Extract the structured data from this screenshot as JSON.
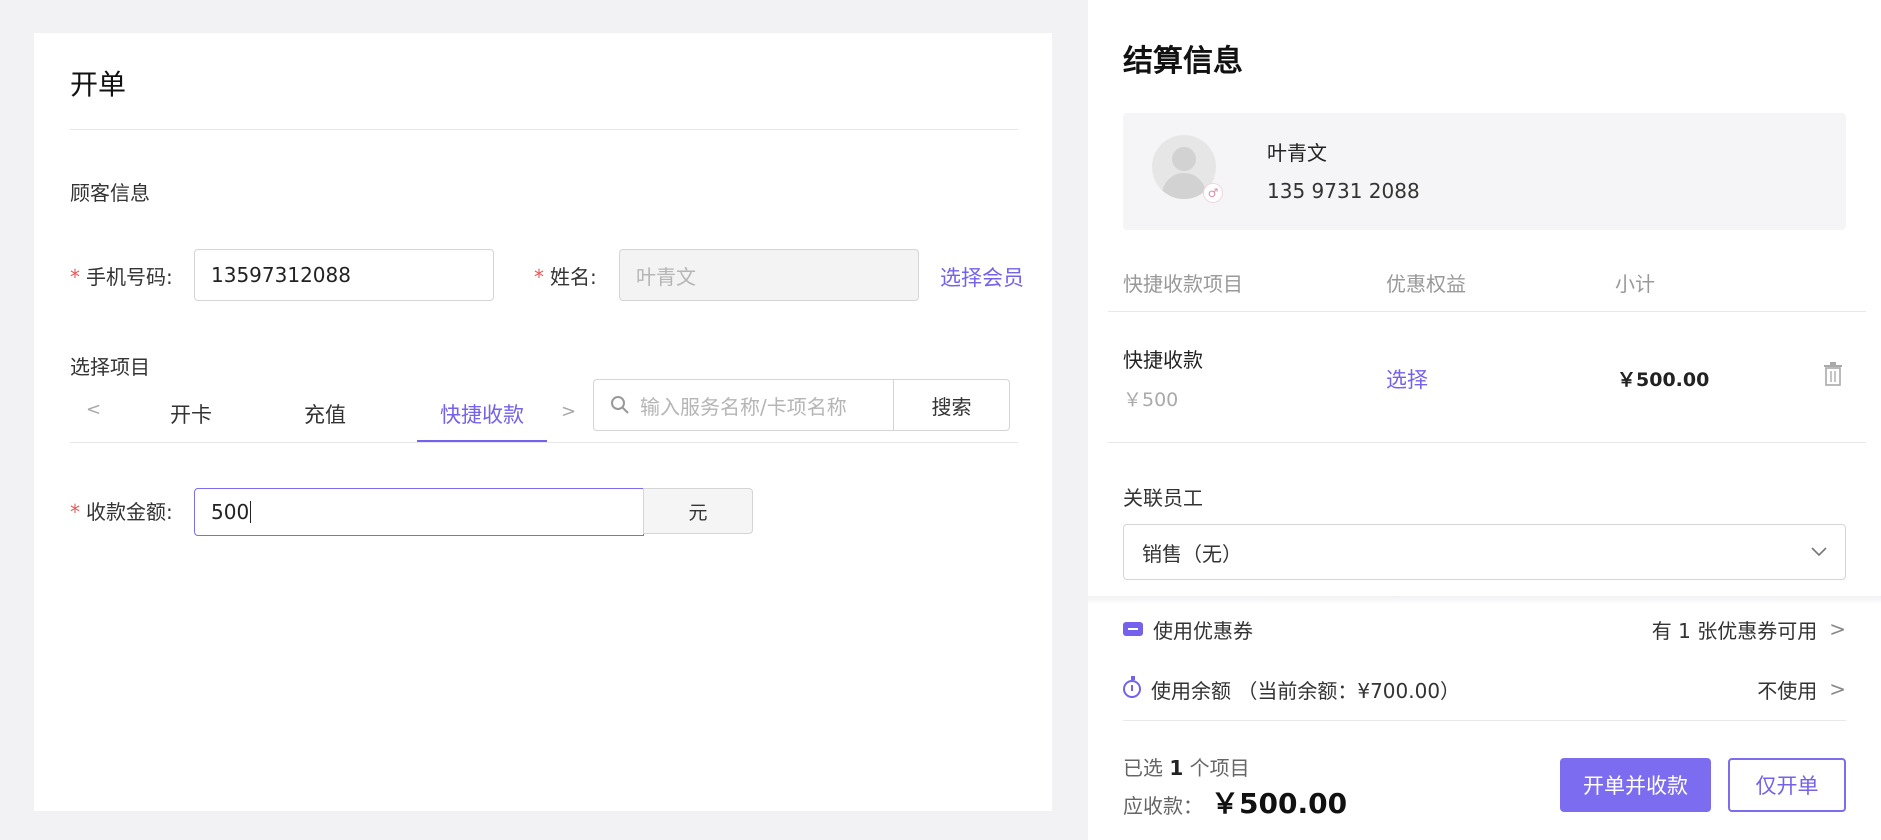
{
  "left": {
    "page_title": "开单",
    "customer_section": "顾客信息",
    "phone_label": "手机号码",
    "phone_value": "13597312088",
    "name_label": "姓名",
    "name_value": "叶青文",
    "select_member": "选择会员",
    "project_section": "选择项目",
    "tabs": [
      "开卡",
      "充值",
      "快捷收款"
    ],
    "active_tab": "快捷收款",
    "search_placeholder": "输入服务名称/卡项名称",
    "search_button": "搜索",
    "amount_label": "收款金额",
    "amount_value": "500",
    "amount_unit": "元",
    "required_mark": "*",
    "label_colon": ":"
  },
  "right": {
    "title": "结算信息",
    "member": {
      "name": "叶青文",
      "phone": "135 9731 2088"
    },
    "table_headers": [
      "快捷收款项目",
      "优惠权益",
      "小计"
    ],
    "item": {
      "name": "快捷收款",
      "price": "￥500",
      "benefit_action": "选择",
      "subtotal": "￥500.00"
    },
    "staff_label": "关联员工",
    "staff_value": "销售（无）",
    "coupon_label": "使用优惠券",
    "coupon_status": "有 1 张优惠券可用",
    "balance_label": "使用余额 （当前余额：¥700.00）",
    "balance_status": "不使用",
    "selected_prefix": "已选",
    "selected_count": "1",
    "selected_suffix": "个项目",
    "due_label": "应收款：",
    "due_amount": "￥500.00",
    "btn_open_and_collect": "开单并收款",
    "btn_open_only": "仅开单"
  },
  "colors": {
    "accent": "#7461ec",
    "required": "#e25b5b"
  }
}
